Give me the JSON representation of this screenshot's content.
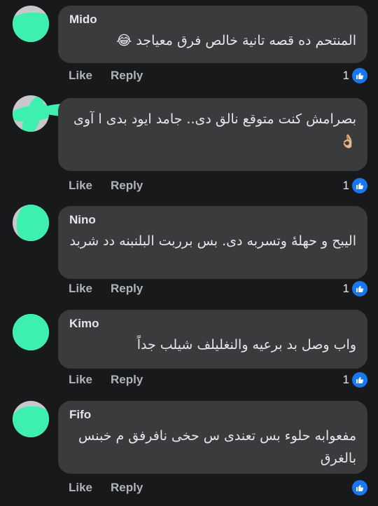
{
  "comments": [
    {
      "author": "Mido",
      "text": "المنتحم ده قصه تانية خالص فرق معياجد 😂",
      "like": "Like",
      "reply": "Reply",
      "count": "1"
    },
    {
      "author": "",
      "text": "بصرامش كنت متوقع نالق دى.. جامد ايود بدى ا آوى 👌🏼",
      "like": "Like",
      "reply": "Reply",
      "count": "1"
    },
    {
      "author": "Nino",
      "text": "اليبح و حهلهٔ وتسربه دی. بس برربت البلنبنه دد شربد",
      "like": "Like",
      "reply": "Reply",
      "count": "1"
    },
    {
      "author": "Kimo",
      "text": "واب   وصل بد برعيه والنغليلف شيلب جداً",
      "like": "Like",
      "reply": "Reply",
      "count": "1"
    },
    {
      "author": "Fifo",
      "text": "مفعوابه حلوء بس تعندی س حخی نافرفق م خبنس بالغرق",
      "like": "Like",
      "reply": "Reply",
      "count": ""
    }
  ],
  "colors": {
    "background": "#18191a",
    "bubble": "#3a3b3c",
    "scribble": "#3ef0b0",
    "like_badge": "#1877f2"
  },
  "icons": {
    "reaction": "thumbs-up-icon"
  }
}
